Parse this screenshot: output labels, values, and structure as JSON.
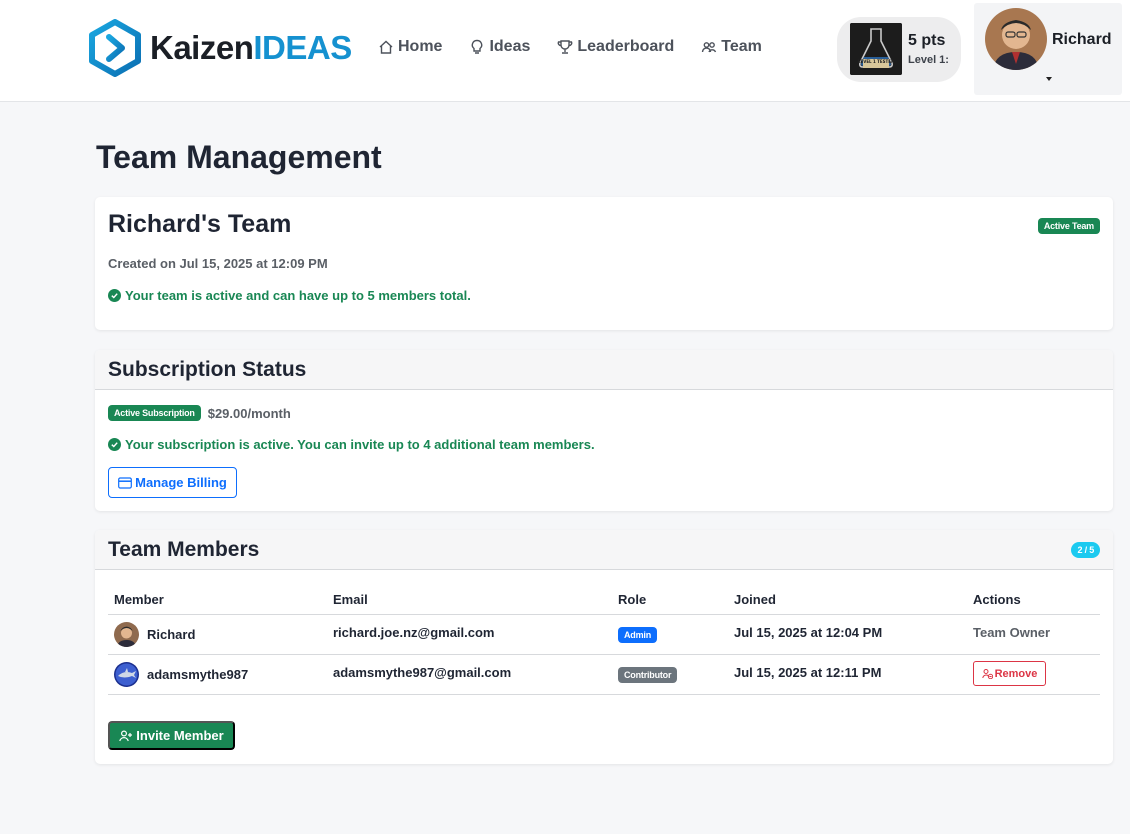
{
  "brand": {
    "kaizen": "Kaizen",
    "ideas": "IDEAS"
  },
  "nav": [
    {
      "label": "Home",
      "icon": "house-icon"
    },
    {
      "label": "Ideas",
      "icon": "lightbulb-icon"
    },
    {
      "label": "Leaderboard",
      "icon": "trophy-icon"
    },
    {
      "label": "Team",
      "icon": "people-icon"
    }
  ],
  "points": {
    "value": "5 pts",
    "level": "Level 1:",
    "badge_text": "LEVEL 1 TESTER"
  },
  "user": {
    "name": "Richard"
  },
  "page": {
    "title": "Team Management"
  },
  "team": {
    "name": "Richard's Team",
    "status_badge": "Active Team",
    "created": "Created on Jul 15, 2025 at 12:09 PM",
    "message": "Your team is active and can have up to 5 members total."
  },
  "subscription": {
    "heading": "Subscription Status",
    "badge": "Active Subscription",
    "price": "$29.00/month",
    "message": "Your subscription is active. You can invite up to 4 additional team members.",
    "manage_label": "Manage Billing"
  },
  "members": {
    "heading": "Team Members",
    "count": "2 / 5",
    "columns": [
      "Member",
      "Email",
      "Role",
      "Joined",
      "Actions"
    ],
    "rows": [
      {
        "name": "Richard",
        "email": "richard.joe.nz@gmail.com",
        "role": "Admin",
        "joined": "Jul 15, 2025 at 12:04 PM",
        "action": "Team Owner"
      },
      {
        "name": "adamsmythe987",
        "email": "adamsmythe987@gmail.com",
        "role": "Contributor",
        "joined": "Jul 15, 2025 at 12:11 PM",
        "action": "Remove"
      }
    ],
    "invite_label": "Invite Member"
  },
  "colors": {
    "accent": "#1591d0",
    "success": "#198754",
    "primary": "#0d6efd",
    "danger": "#dc3545",
    "info": "#1ccaf0"
  }
}
